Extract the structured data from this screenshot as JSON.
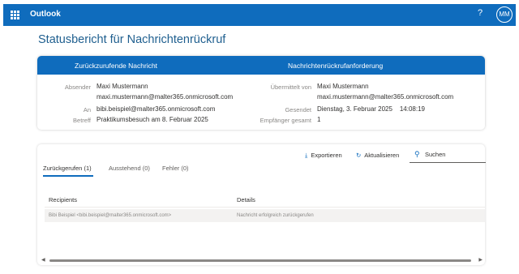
{
  "app": {
    "name": "Outlook",
    "help_icon": "?",
    "avatar_initials": "MM"
  },
  "page": {
    "title": "Statusbericht für Nachrichtenrückruf"
  },
  "info": {
    "left_header": "Zurückzurufende Nachricht",
    "right_header": "Nachrichtenrückrufanforderung",
    "sender_label": "Absender",
    "sender_name": "Maxi Mustermann",
    "sender_email": "maxi.mustermann@malter365.onmicrosoft.com",
    "to_label": "An",
    "to_value": "bibi.beispiel@malter365.onmicrosoft.com",
    "subject_label": "Betreff",
    "subject_value": "Praktikumsbesuch am 8. Februar 2025",
    "submitted_by_label": "Übermittelt von",
    "submitted_by_name": "Maxi Mustermann",
    "submitted_by_email": "maxi.mustermann@malter365.onmicrosoft.com",
    "sent_label": "Gesendet",
    "sent_value": "Dienstag, 3. Februar 2025    14:08:19",
    "recipients_total_label": "Empfänger gesamt",
    "recipients_total_value": "1"
  },
  "toolbar": {
    "export_label": "Exportieren",
    "refresh_label": "Aktualisieren",
    "search_placeholder": "Suchen"
  },
  "tabs": [
    {
      "label": "Zurückgerufen (1)"
    },
    {
      "label": "Ausstehend (0)"
    },
    {
      "label": "Fehler (0)"
    }
  ],
  "table": {
    "columns": [
      "Recipients",
      "Details"
    ],
    "rows": [
      {
        "recipient": "Bibi Beispiel <bibi.beispiel@malter365.onmicrosoft.com>",
        "details": "Nachricht erfolgreich zurückgerufen"
      }
    ]
  },
  "colors": {
    "brand": "#0f6cbd"
  }
}
